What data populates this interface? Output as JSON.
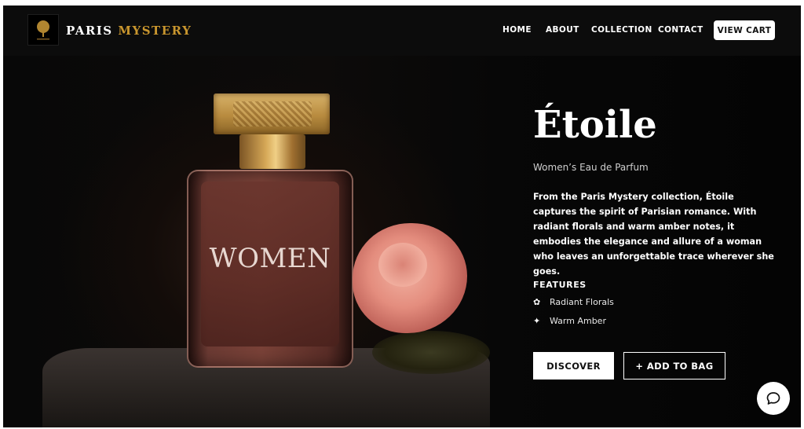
{
  "brand": {
    "name_part1": "PARIS",
    "name_part2": "MYSTERY",
    "accent_color": "#c9962e",
    "logo": "tree-logo-icon"
  },
  "nav": {
    "items": [
      {
        "label": "HOME"
      },
      {
        "label": "ABOUT"
      },
      {
        "label": "COLLECTION"
      },
      {
        "label": "CONTACT"
      }
    ],
    "cart_label": "VIEW CART"
  },
  "hero": {
    "bottle_label": "WOMEN",
    "title": "Étoile",
    "subtitle": "Women’s Eau de Parfum",
    "description": "From the Paris Mystery collection, Étoile captures the spirit of Parisian romance. With radiant florals and warm amber notes, it embodies the elegance and allure of a woman who leaves an unforgettable trace wherever she goes.",
    "features_heading": "FEATURES",
    "features": [
      {
        "icon": "flower-icon",
        "glyph": "✿",
        "label": "Radiant Florals"
      },
      {
        "icon": "sparkle-icon",
        "glyph": "✦",
        "label": "Warm Amber"
      }
    ],
    "discover_label": "DISCOVER",
    "add_to_bag_label": "+ ADD TO BAG"
  },
  "chat": {
    "icon": "chat-bubble-icon"
  }
}
